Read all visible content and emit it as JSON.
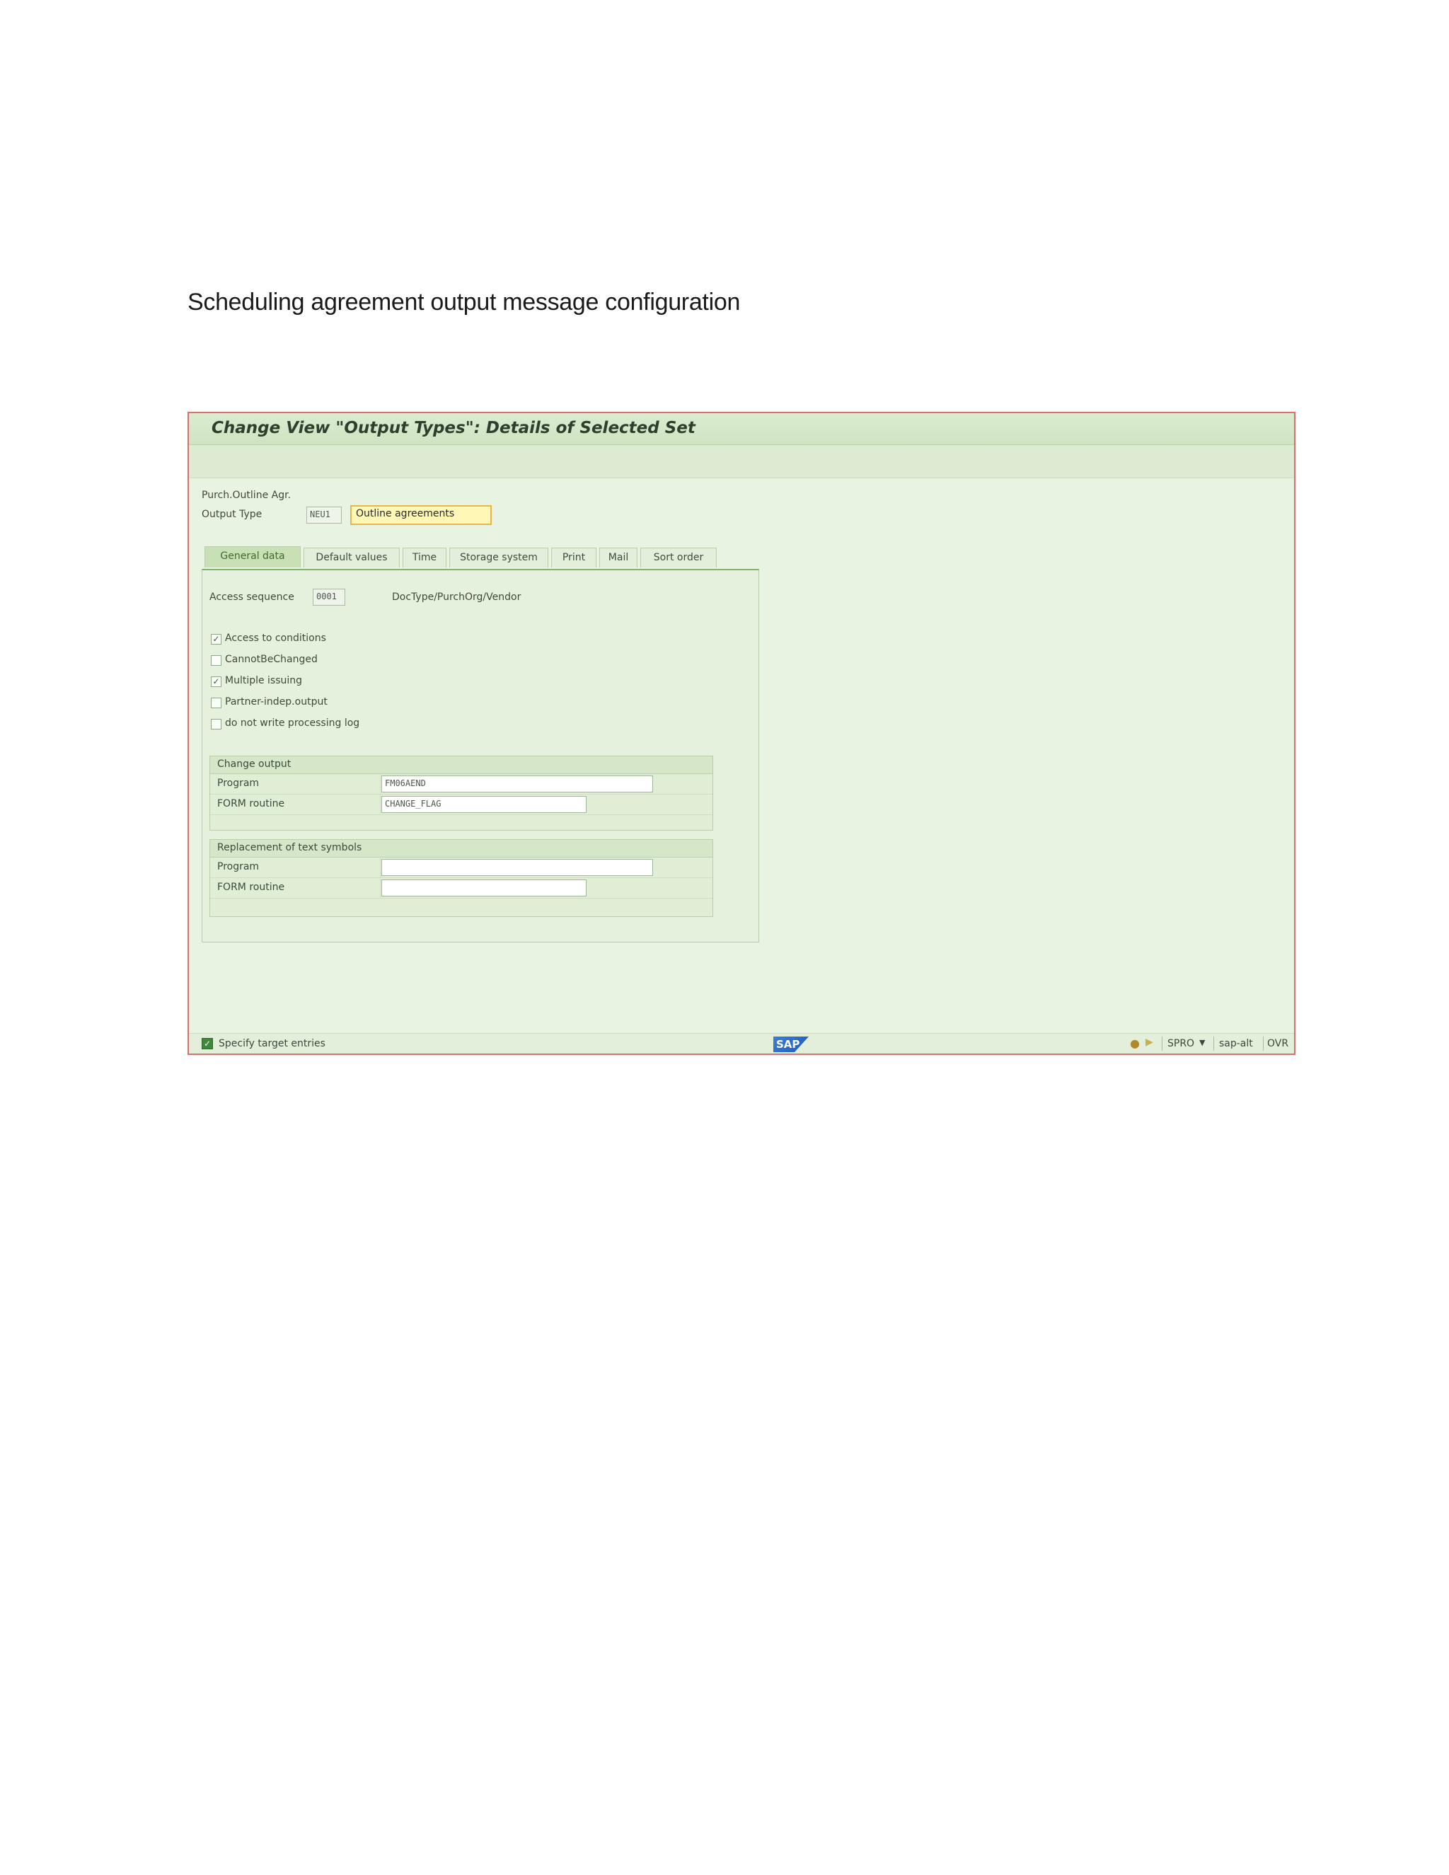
{
  "document": {
    "heading": "Scheduling agreement output message configuration"
  },
  "window": {
    "title": "Change View \"Output Types\": Details of Selected Set"
  },
  "header_fields": {
    "application_label": "Purch.Outline Agr.",
    "output_type_label": "Output Type",
    "output_type_code": "NEU1",
    "output_type_description": "Outline agreements"
  },
  "tabs": [
    {
      "label": "General data",
      "active": true
    },
    {
      "label": "Default values",
      "active": false
    },
    {
      "label": "Time",
      "active": false
    },
    {
      "label": "Storage system",
      "active": false
    },
    {
      "label": "Print",
      "active": false
    },
    {
      "label": "Mail",
      "active": false
    },
    {
      "label": "Sort order",
      "active": false
    }
  ],
  "general_data": {
    "access_sequence_label": "Access sequence",
    "access_sequence_value": "0001",
    "access_sequence_text": "DocType/PurchOrg/Vendor",
    "checkboxes": [
      {
        "label": "Access to conditions",
        "checked": true
      },
      {
        "label": "CannotBeChanged",
        "checked": false
      },
      {
        "label": "Multiple issuing",
        "checked": true
      },
      {
        "label": "Partner-indep.output",
        "checked": false
      },
      {
        "label": "do not write processing log",
        "checked": false
      }
    ],
    "change_output": {
      "title": "Change output",
      "program_label": "Program",
      "program_value": "FM06AEND",
      "form_label": "FORM routine",
      "form_value": "CHANGE_FLAG"
    },
    "replacement": {
      "title": "Replacement of text symbols",
      "program_label": "Program",
      "program_value": "",
      "form_label": "FORM routine",
      "form_value": ""
    }
  },
  "status_bar": {
    "message": "Specify target entries",
    "logo": "SAP",
    "transaction": "SPRO",
    "server": "sap-alt",
    "mode": "OVR"
  },
  "colors": {
    "window_bg": "#e9f3e1",
    "title_bar": "#d6e9c9",
    "active_tab": "#c9e0b7",
    "highlight_field": "#fff7b5",
    "window_border": "#d97070"
  }
}
